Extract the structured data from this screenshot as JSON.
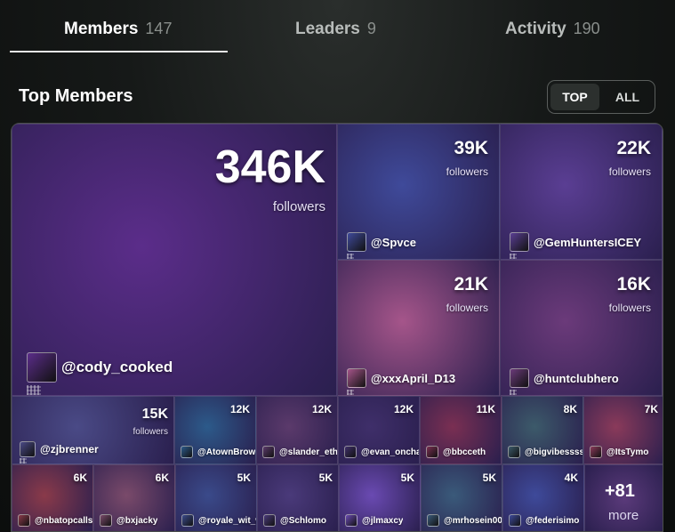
{
  "tabs": [
    {
      "label": "Members",
      "count": "147"
    },
    {
      "label": "Leaders",
      "count": "9"
    },
    {
      "label": "Activity",
      "count": "190"
    }
  ],
  "section_title": "Top Members",
  "toggle": {
    "top": "TOP",
    "all": "ALL"
  },
  "followers_label": "followers",
  "members": [
    {
      "count": "346K",
      "user": "@cody_cooked",
      "bg": "#5b2d8a"
    },
    {
      "count": "39K",
      "user": "@Spvce",
      "bg": "#3f4a9a"
    },
    {
      "count": "22K",
      "user": "@GemHuntersICEY",
      "bg": "#5a3e93"
    },
    {
      "count": "21K",
      "user": "@xxxApril_D13",
      "bg": "#a5558a"
    },
    {
      "count": "16K",
      "user": "@huntclubhero",
      "bg": "#6b3a7a"
    },
    {
      "count": "15K",
      "user": "@zjbrenner",
      "bg": "#4a4a86"
    },
    {
      "count": "12K",
      "user": "@AtownBrow",
      "bg": "#2c5a8a"
    },
    {
      "count": "12K",
      "user": "@slander_eth",
      "bg": "#5b3a6b"
    },
    {
      "count": "12K",
      "user": "@evan_oncha",
      "bg": "#3f2f6a"
    },
    {
      "count": "11K",
      "user": "@bbcceth",
      "bg": "#7a2f52"
    },
    {
      "count": "8K",
      "user": "@bigvibessss",
      "bg": "#3c5a6a"
    },
    {
      "count": "7K",
      "user": "@ItsTymo",
      "bg": "#8a3a5a"
    },
    {
      "count": "6K",
      "user": "@nbatopcalls",
      "bg": "#8a3a4a"
    },
    {
      "count": "6K",
      "user": "@bxjacky",
      "bg": "#7a4a6a"
    },
    {
      "count": "5K",
      "user": "@royale_wit_w",
      "bg": "#3a4a8a"
    },
    {
      "count": "5K",
      "user": "@Schlomo",
      "bg": "#4a3a7a"
    },
    {
      "count": "5K",
      "user": "@jlmaxcy",
      "bg": "#6a4ab2"
    },
    {
      "count": "5K",
      "user": "@mrhosein00",
      "bg": "#3a5a7a"
    },
    {
      "count": "4K",
      "user": "@federisimo",
      "bg": "#3e4a9a"
    }
  ],
  "more": {
    "count": "+81",
    "label": "more"
  }
}
